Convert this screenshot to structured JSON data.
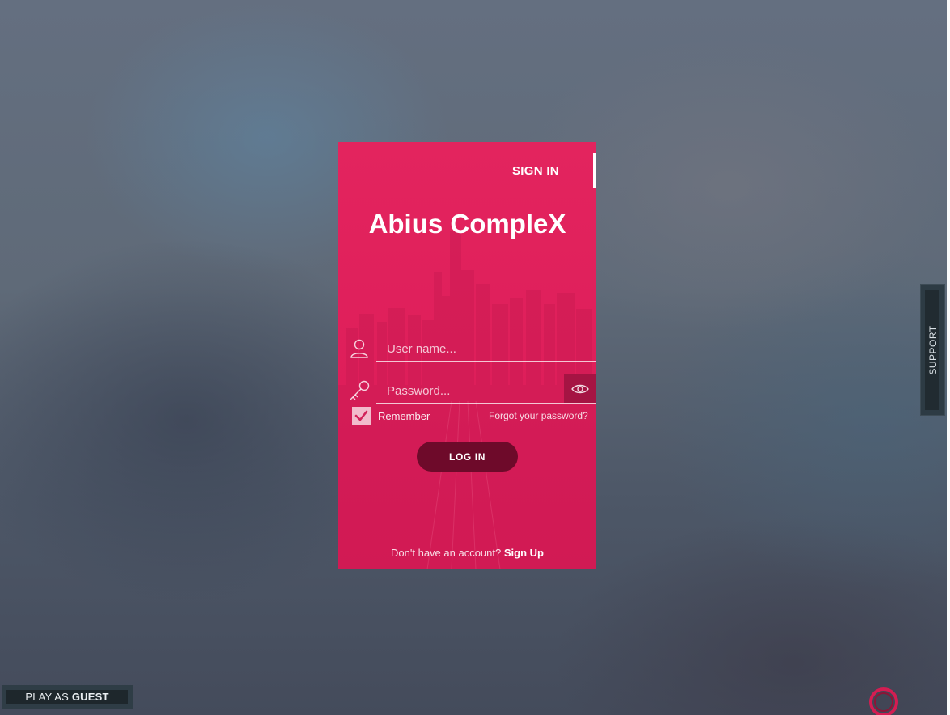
{
  "login": {
    "tab_label": "SIGN IN",
    "title": "Abius CompleX",
    "username": {
      "placeholder": "User name...",
      "value": ""
    },
    "password": {
      "placeholder": "Password...",
      "value": ""
    },
    "show_password_icon": "eye-icon",
    "remember_label": "Remember",
    "remember_checked": true,
    "forgot_label": "Forgot your password?",
    "login_button": "LOG IN",
    "signup_prompt": "Don't have an account?",
    "signup_link": "Sign Up"
  },
  "support": {
    "label": "SUPPORT"
  },
  "guest": {
    "prefix": "PLAY AS",
    "emphasis": "GUEST"
  },
  "colors": {
    "card": "#e0215c",
    "button_dark": "#6e0a2a",
    "eye_button": "#a51443",
    "panel_dark": "#2d3b44"
  }
}
